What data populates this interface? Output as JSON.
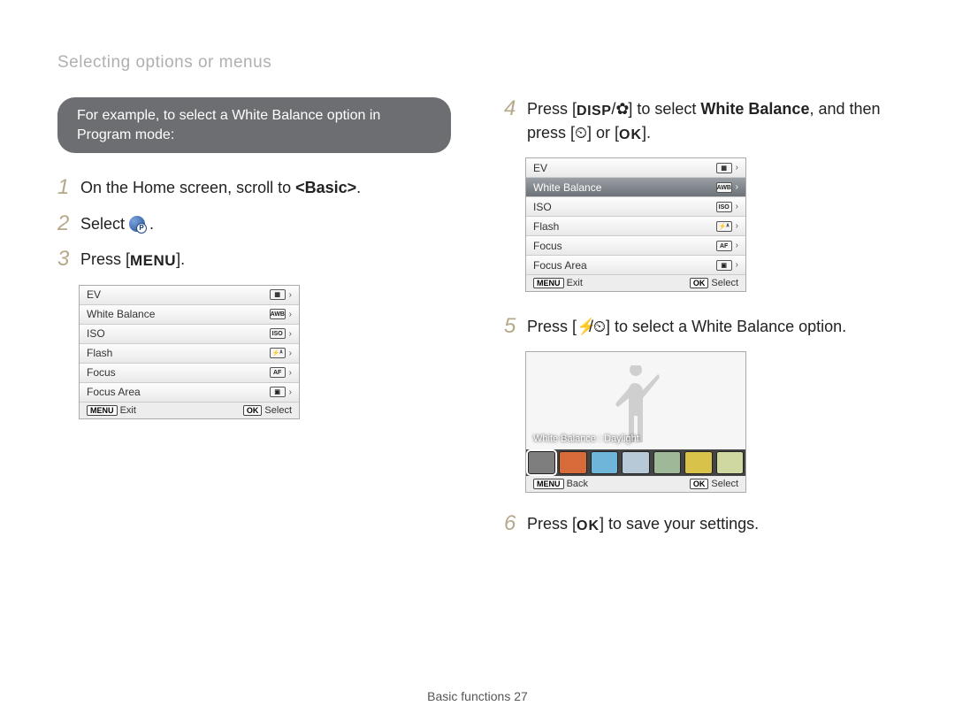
{
  "header": {
    "title": "Selecting options or menus"
  },
  "callout": {
    "text_a": "For example, to select a White Balance option in",
    "text_b": "Program mode:"
  },
  "labels": {
    "menu": "MENU",
    "disp": "DISP",
    "ok": "OK"
  },
  "steps": {
    "s1_a": "On the Home screen, scroll to ",
    "s1_b": "<Basic>",
    "s1_c": ".",
    "s2_a": "Select ",
    "s2_b": ".",
    "s3_a": "Press [",
    "s3_b": "].",
    "s4_a": "Press [",
    "s4_b": "/",
    "s4_c": "] to select ",
    "s4_d": "White Balance",
    "s4_e": ", and then press [",
    "s4_f": "] or [",
    "s4_g": "].",
    "s5_a": "Press [",
    "s5_b": "/",
    "s5_c": "] to select a White Balance option.",
    "s6_a": "Press [",
    "s6_b": "] to save your settings."
  },
  "step_numbers": {
    "n1": "1",
    "n2": "2",
    "n3": "3",
    "n4": "4",
    "n5": "5",
    "n6": "6"
  },
  "icons": {
    "flower": "✿",
    "timer": "⏲",
    "bolt": "⚡",
    "chev": "›"
  },
  "menu_panel": {
    "items": [
      {
        "label": "EV",
        "icon": "▦"
      },
      {
        "label": "White Balance",
        "icon": "AWB"
      },
      {
        "label": "ISO",
        "icon": "ISO"
      },
      {
        "label": "Flash",
        "icon": "⚡ᴬ"
      },
      {
        "label": "Focus",
        "icon": "AF"
      },
      {
        "label": "Focus Area",
        "icon": "▣"
      }
    ],
    "footer": {
      "left_pill": "MENU",
      "left_text": "Exit",
      "right_pill": "OK",
      "right_text": "Select"
    }
  },
  "wb_preview": {
    "label": "White Balance : Daylight",
    "footer": {
      "left_pill": "MENU",
      "left_text": "Back",
      "right_pill": "OK",
      "right_text": "Select"
    },
    "thumb_colors": [
      "#7e7e7e",
      "#d86b3a",
      "#6fb5d9",
      "#b7c8d6",
      "#9fb897",
      "#d8c24a",
      "#cfd8a0"
    ]
  },
  "page_footer": {
    "section": "Basic functions  ",
    "num": "27"
  }
}
